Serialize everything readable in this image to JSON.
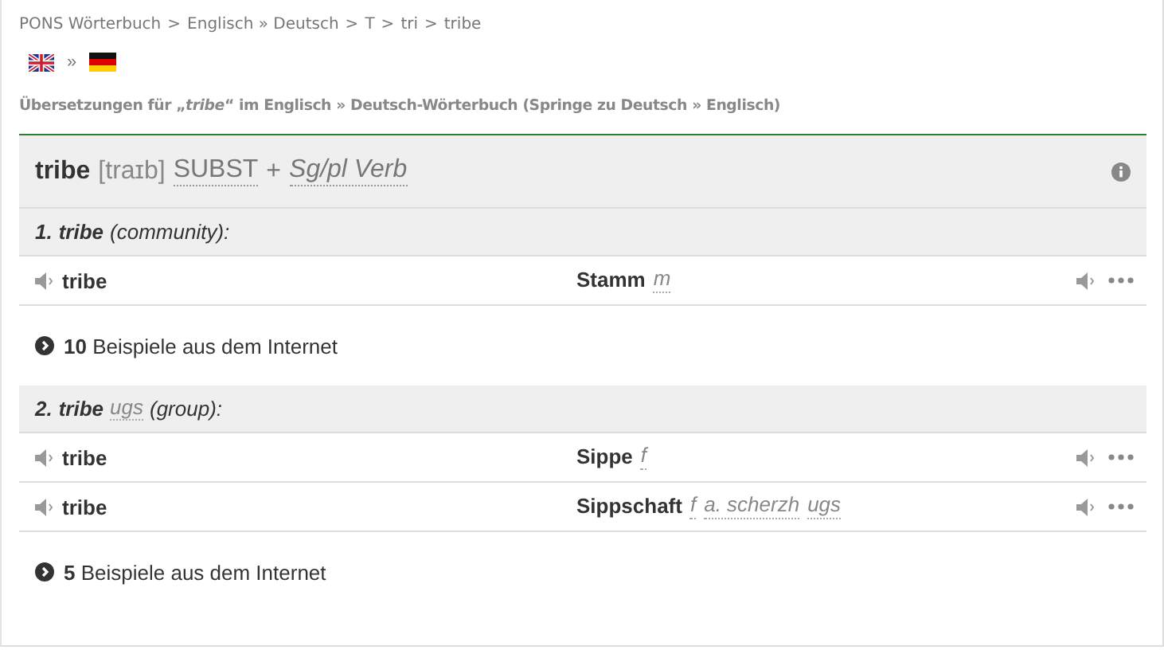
{
  "breadcrumb": [
    {
      "label": "PONS Wörterbuch",
      "separator": ">"
    },
    {
      "label": "Englisch » Deutsch",
      "separator": ">"
    },
    {
      "label": "T",
      "separator": ">"
    },
    {
      "label": "tri",
      "separator": ">"
    },
    {
      "label": "tribe"
    }
  ],
  "languages": {
    "separator": "»"
  },
  "subtitle": "Übersetzungen für „*tribe*“ im Englisch » Deutsch-Wörterbuch (Springe zu Deutsch » Englisch)",
  "entry": {
    "headword": "tribe",
    "phonetics": "[traɪb]",
    "pos": "SUBST",
    "plus": "+",
    "grammar": "Sg/pl Verb",
    "senses": [
      {
        "number": "1.",
        "headword": "tribe",
        "gloss": "(community):",
        "rows": [
          {
            "source": "tribe",
            "target": "Stamm",
            "labels": [
              "m"
            ]
          }
        ],
        "examples": "**10** Beispiele aus dem Internet"
      },
      {
        "number": "2.",
        "headword": "tribe",
        "labels": [
          "ugs"
        ],
        "gloss": "(group):",
        "rows": [
          {
            "source": "tribe",
            "target": "Sippe",
            "labels": [
              "f"
            ]
          },
          {
            "source": "tribe",
            "target": "Sippschaft",
            "labels": [
              "f",
              "a. scherzh",
              "ugs"
            ]
          }
        ],
        "examples": "**5** Beispiele aus dem Internet"
      }
    ]
  }
}
